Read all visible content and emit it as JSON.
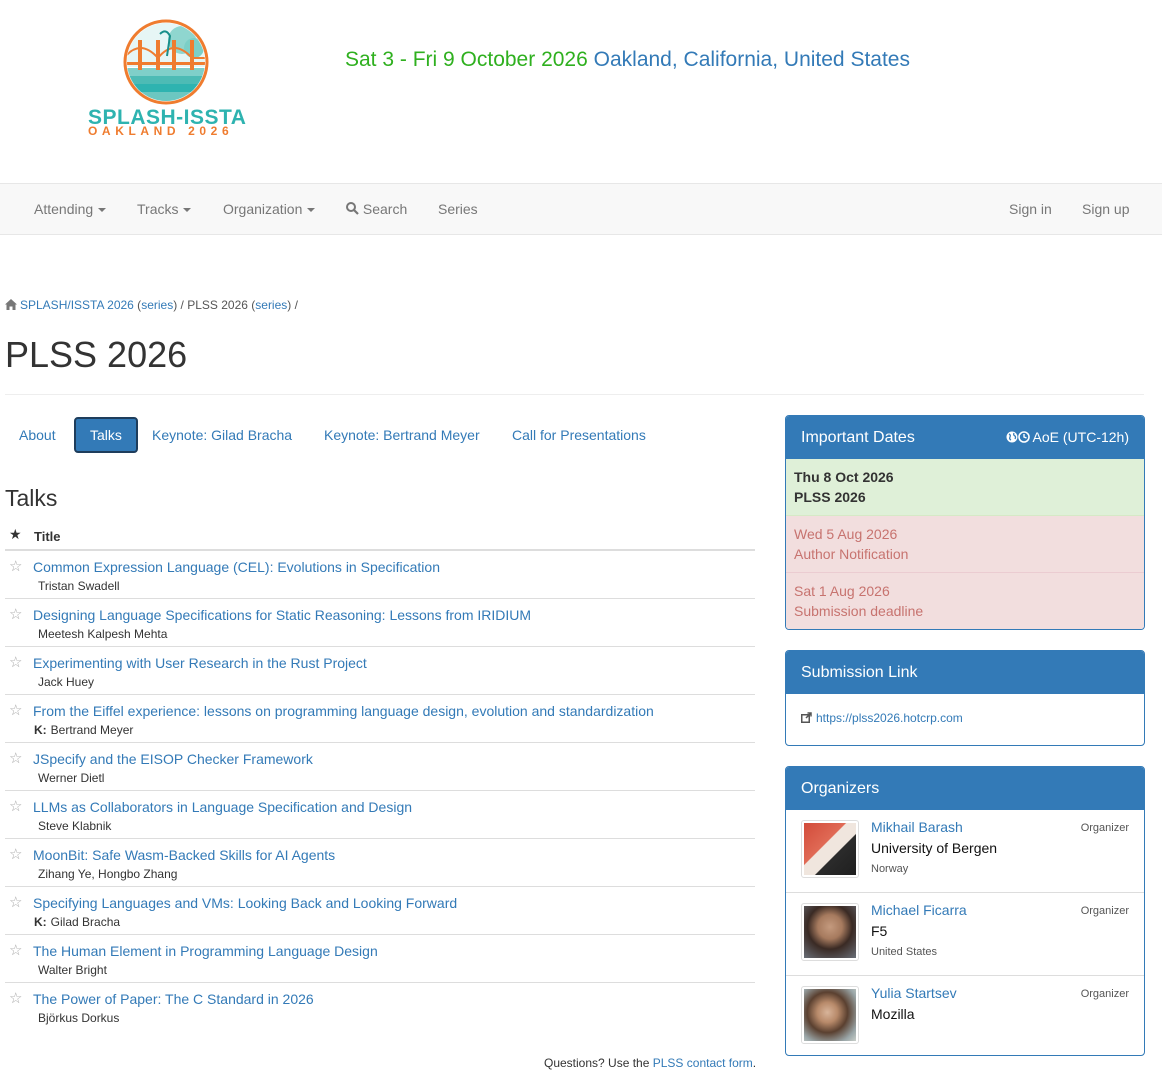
{
  "header": {
    "logo_line1": "SPLASH-ISSTA",
    "logo_line2": "OAKLAND 2026",
    "dates": "Sat 3 - Fri 9 October 2026",
    "place": "Oakland, California, United States"
  },
  "nav": {
    "attending": "Attending",
    "tracks": "Tracks",
    "organization": "Organization",
    "search": "Search",
    "series": "Series",
    "sign_in": "Sign in",
    "sign_up": "Sign up"
  },
  "breadcrumb": {
    "home": "SPLASH/ISSTA 2026",
    "home_series": "series",
    "track": "PLSS 2026",
    "track_series": "series"
  },
  "page_title": "PLSS 2026",
  "tabs": [
    "About",
    "Talks",
    "Keynote: Gilad Bracha",
    "Keynote: Bertrand Meyer",
    "Call for Presentations"
  ],
  "talks": {
    "heading": "Talks",
    "column_title": "Title",
    "rows": [
      {
        "title": "Common Expression Language (CEL): Evolutions in Specification",
        "prefix": "",
        "people": "Tristan Swadell"
      },
      {
        "title": "Designing Language Specifications for Static Reasoning: Lessons from IRIDIUM",
        "prefix": "",
        "people": "Meetesh Kalpesh Mehta"
      },
      {
        "title": "Experimenting with User Research in the Rust Project",
        "prefix": "",
        "people": "Jack Huey"
      },
      {
        "title": "From the Eiffel experience: lessons on programming language design, evolution and standardization",
        "prefix": "K:",
        "people": "Bertrand Meyer"
      },
      {
        "title": "JSpecify and the EISOP Checker Framework",
        "prefix": "",
        "people": "Werner Dietl"
      },
      {
        "title": "LLMs as Collaborators in Language Specification and Design",
        "prefix": "",
        "people": "Steve Klabnik"
      },
      {
        "title": "MoonBit: Safe Wasm-Backed Skills for AI Agents",
        "prefix": "",
        "people": "Zihang Ye, Hongbo Zhang"
      },
      {
        "title": "Specifying Languages and VMs: Looking Back and Looking Forward",
        "prefix": "K:",
        "people": "Gilad Bracha"
      },
      {
        "title": "The Human Element in Programming Language Design",
        "prefix": "",
        "people": "Walter Bright"
      },
      {
        "title": "The Power of Paper: The C Standard in 2026",
        "prefix": "",
        "people": "Björkus Dorkus"
      }
    ],
    "contact_prefix": "Questions? Use the",
    "contact_link": "PLSS contact form",
    "contact_suffix": "."
  },
  "important_dates": {
    "title": "Important Dates",
    "timezone": "AoE (UTC-12h)",
    "items": [
      {
        "date": "Thu 8 Oct 2026",
        "label": "PLSS 2026",
        "status": "current"
      },
      {
        "date": "Wed 5 Aug 2026",
        "label": "Author Notification",
        "status": "past"
      },
      {
        "date": "Sat 1 Aug 2026",
        "label": "Submission deadline",
        "status": "past"
      }
    ]
  },
  "submission": {
    "title": "Submission Link",
    "url": "https://plss2026.hotcrp.com"
  },
  "organizers": {
    "title": "Organizers",
    "people": [
      {
        "name": "Mikhail Barash",
        "role": "Organizer",
        "affiliation": "University of Bergen",
        "country": "Norway"
      },
      {
        "name": "Michael Ficarra",
        "role": "Organizer",
        "affiliation": "F5",
        "country": "United States"
      },
      {
        "name": "Yulia Startsev",
        "role": "Organizer",
        "affiliation": "Mozilla",
        "country": ""
      }
    ]
  },
  "colors": {
    "link": "#337ab7",
    "dates_green": "#2fb01f",
    "panel_blue": "#337ab7"
  }
}
